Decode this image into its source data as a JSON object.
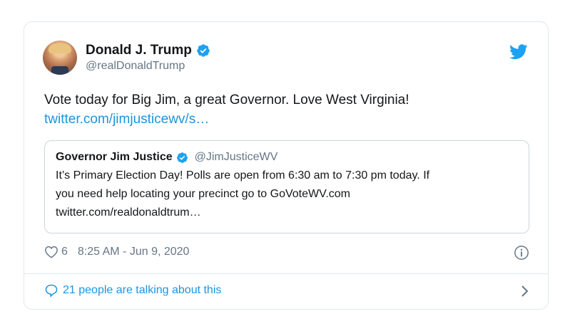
{
  "author": {
    "display_name": "Donald J. Trump",
    "handle": "@realDonaldTrump"
  },
  "tweet": {
    "text": "Vote today for Big Jim, a great Governor. Love West Virginia!",
    "link": "twitter.com/jimjusticewv/s…"
  },
  "quote": {
    "display_name": "Governor Jim Justice",
    "handle": "@JimJusticeWV",
    "line1": "It’s Primary Election Day! Polls are open from 6:30 am to 7:30 pm today. If",
    "line2": "you need help locating your precinct go to GoVoteWV.com",
    "line3": "twitter.com/realdonaldtrum…"
  },
  "meta": {
    "likes": "6",
    "timestamp": "8:25 AM - Jun 9, 2020"
  },
  "footer": {
    "talking": "21 people are talking about this"
  },
  "colors": {
    "twitter_blue": "#1da1f2",
    "link_blue": "#1b95e0",
    "muted": "#657786",
    "border": "#e1e8ed"
  },
  "icons": [
    "verified-badge-icon",
    "twitter-bird-icon",
    "heart-icon",
    "info-icon",
    "speech-bubble-icon",
    "chevron-right-icon"
  ]
}
